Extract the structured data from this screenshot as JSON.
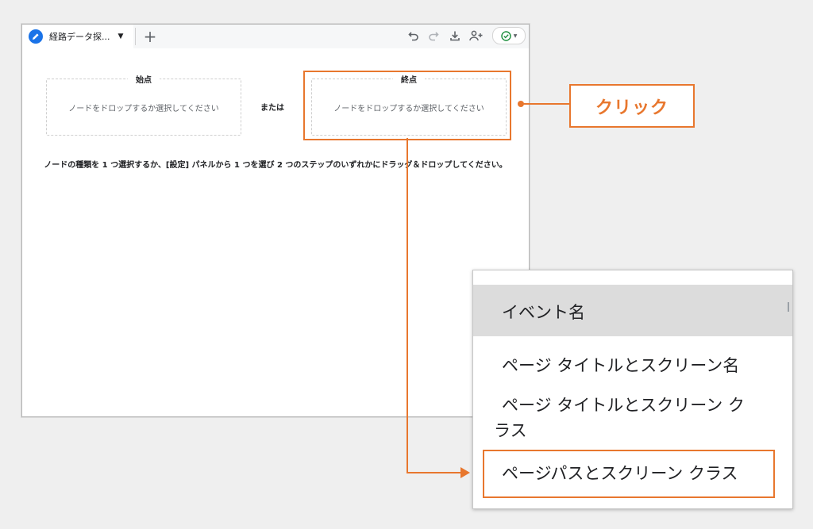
{
  "window": {
    "tab_title": "経路データ探...",
    "add_tab": "+"
  },
  "toolbar": {
    "undo_icon": "undo-icon",
    "redo_icon": "redo-icon",
    "download_icon": "download-icon",
    "share_icon": "share-user-icon",
    "status_icon": "check-circle-icon"
  },
  "canvas": {
    "start_label": "始点",
    "end_label": "終点",
    "drop_hint": "ノードをドロップするか選択してください",
    "or_text": "または",
    "instructions": "ノードの種類を 1 つ選択するか、[設定] パネルから 1 つを選び 2 つのステップのいずれかにドラッグ＆ドロップしてください。"
  },
  "callout": {
    "label": "クリック"
  },
  "dropdown": {
    "options": [
      {
        "label": "イベント名",
        "selected": true
      },
      {
        "label": "ページ タイトルとスクリーン名",
        "selected": false
      },
      {
        "label": "ページ タイトルとスクリーン ク",
        "label_line2": "ラス",
        "selected": false
      },
      {
        "label": "ページパスとスクリーン クラス",
        "selected": false
      }
    ]
  },
  "colors": {
    "accent": "#e8772e",
    "brand_blue": "#1a73e8",
    "status_green": "#1e8e3e"
  }
}
